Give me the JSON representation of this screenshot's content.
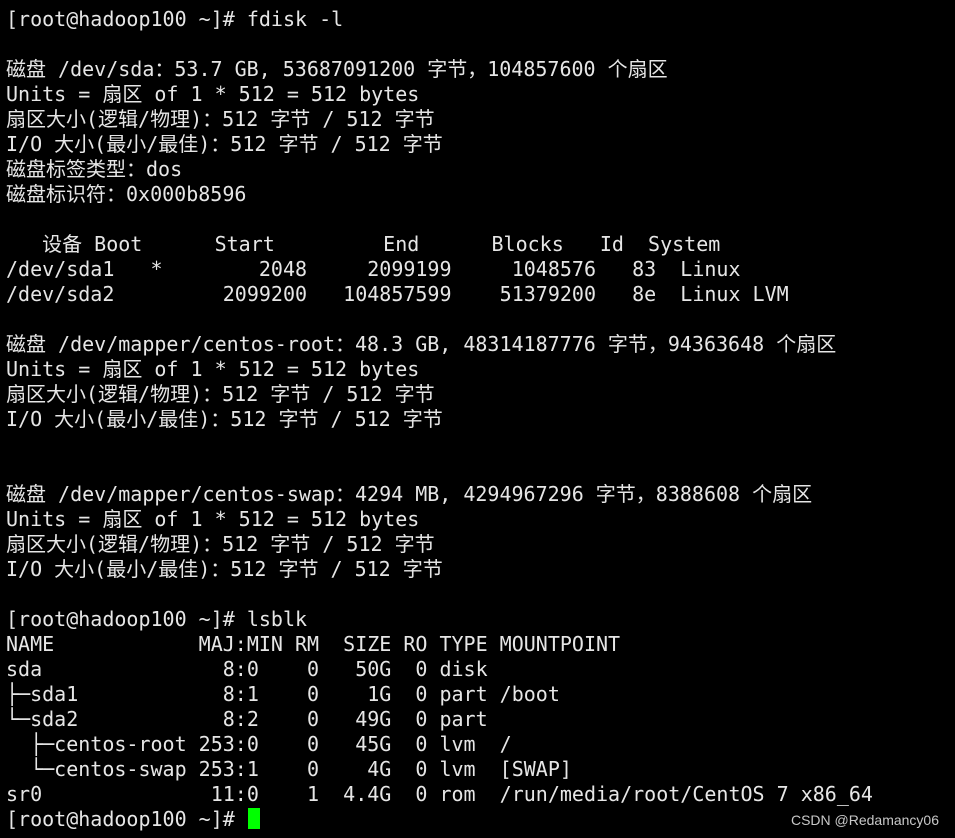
{
  "terminal": {
    "lines": [
      "[root@hadoop100 ~]# fdisk -l",
      "",
      "磁盘 /dev/sda：53.7 GB, 53687091200 字节，104857600 个扇区",
      "Units = 扇区 of 1 * 512 = 512 bytes",
      "扇区大小(逻辑/物理)：512 字节 / 512 字节",
      "I/O 大小(最小/最佳)：512 字节 / 512 字节",
      "磁盘标签类型：dos",
      "磁盘标识符：0x000b8596",
      "",
      "   设备 Boot      Start         End      Blocks   Id  System",
      "/dev/sda1   *        2048     2099199     1048576   83  Linux",
      "/dev/sda2         2099200   104857599    51379200   8e  Linux LVM",
      "",
      "磁盘 /dev/mapper/centos-root：48.3 GB, 48314187776 字节，94363648 个扇区",
      "Units = 扇区 of 1 * 512 = 512 bytes",
      "扇区大小(逻辑/物理)：512 字节 / 512 字节",
      "I/O 大小(最小/最佳)：512 字节 / 512 字节",
      "",
      "",
      "磁盘 /dev/mapper/centos-swap：4294 MB, 4294967296 字节，8388608 个扇区",
      "Units = 扇区 of 1 * 512 = 512 bytes",
      "扇区大小(逻辑/物理)：512 字节 / 512 字节",
      "I/O 大小(最小/最佳)：512 字节 / 512 字节",
      "",
      "[root@hadoop100 ~]# lsblk",
      "NAME            MAJ:MIN RM  SIZE RO TYPE MOUNTPOINT",
      "sda               8:0    0   50G  0 disk",
      "├─sda1            8:1    0    1G  0 part /boot",
      "└─sda2            8:2    0   49G  0 part",
      "  ├─centos-root 253:0    0   45G  0 lvm  /",
      "  └─centos-swap 253:1    0    4G  0 lvm  [SWAP]",
      "sr0              11:0    1  4.4G  0 rom  /run/media/root/CentOS 7 x86_64"
    ],
    "prompt": "[root@hadoop100 ~]# "
  },
  "watermark": "CSDN @Redamancy06",
  "colors": {
    "background": "#000000",
    "foreground": "#e6e6e6",
    "cursor": "#00ff00"
  }
}
